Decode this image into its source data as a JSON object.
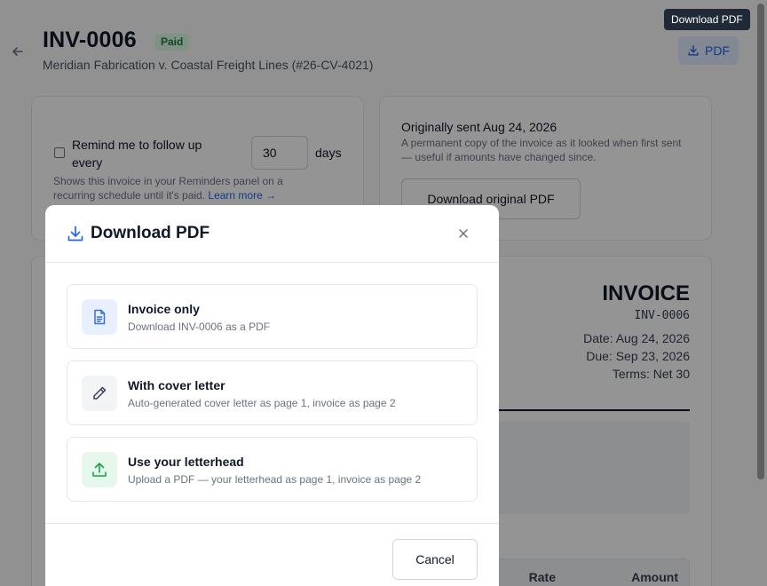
{
  "header": {
    "title": "INV-0006",
    "status_badge": "Paid",
    "subtitle": "Meridian Fabrication v. Coastal Freight Lines (#26-CV-4021)",
    "pdf_button_label": "PDF",
    "tooltip": "Download PDF"
  },
  "reminder": {
    "label": "Remind me to follow up every",
    "days_value": "30",
    "days_unit": "days",
    "help_text": "Shows this invoice in your Reminders panel on a recurring schedule until it's paid.",
    "learn_more": "Learn more →",
    "checked": false
  },
  "original": {
    "title": "Originally sent Aug 24, 2026",
    "description": "A permanent copy of the invoice as it looked when first sent — useful if amounts have changed since.",
    "button_label": "Download original PDF"
  },
  "invoice_preview": {
    "heading": "INVOICE",
    "number": "INV-0006",
    "date": "Date: Aug 24, 2026",
    "due": "Due: Sep 23, 2026",
    "terms": "Terms: Net 30",
    "col_rate": "Rate",
    "col_amount": "Amount"
  },
  "modal": {
    "title": "Download PDF",
    "options": [
      {
        "title": "Invoice only",
        "description": "Download INV-0006 as a PDF",
        "icon": "document-icon"
      },
      {
        "title": "With cover letter",
        "description": "Auto-generated cover letter as page 1, invoice as page 2",
        "icon": "pencil-icon"
      },
      {
        "title": "Use your letterhead",
        "description": "Upload a PDF — your letterhead as page 1, invoice as page 2",
        "icon": "upload-icon"
      }
    ],
    "cancel_label": "Cancel"
  },
  "colors": {
    "accent": "#2563eb",
    "badge_bg": "#dcfce7",
    "badge_text": "#15803d",
    "upload_green": "#16a34a"
  }
}
